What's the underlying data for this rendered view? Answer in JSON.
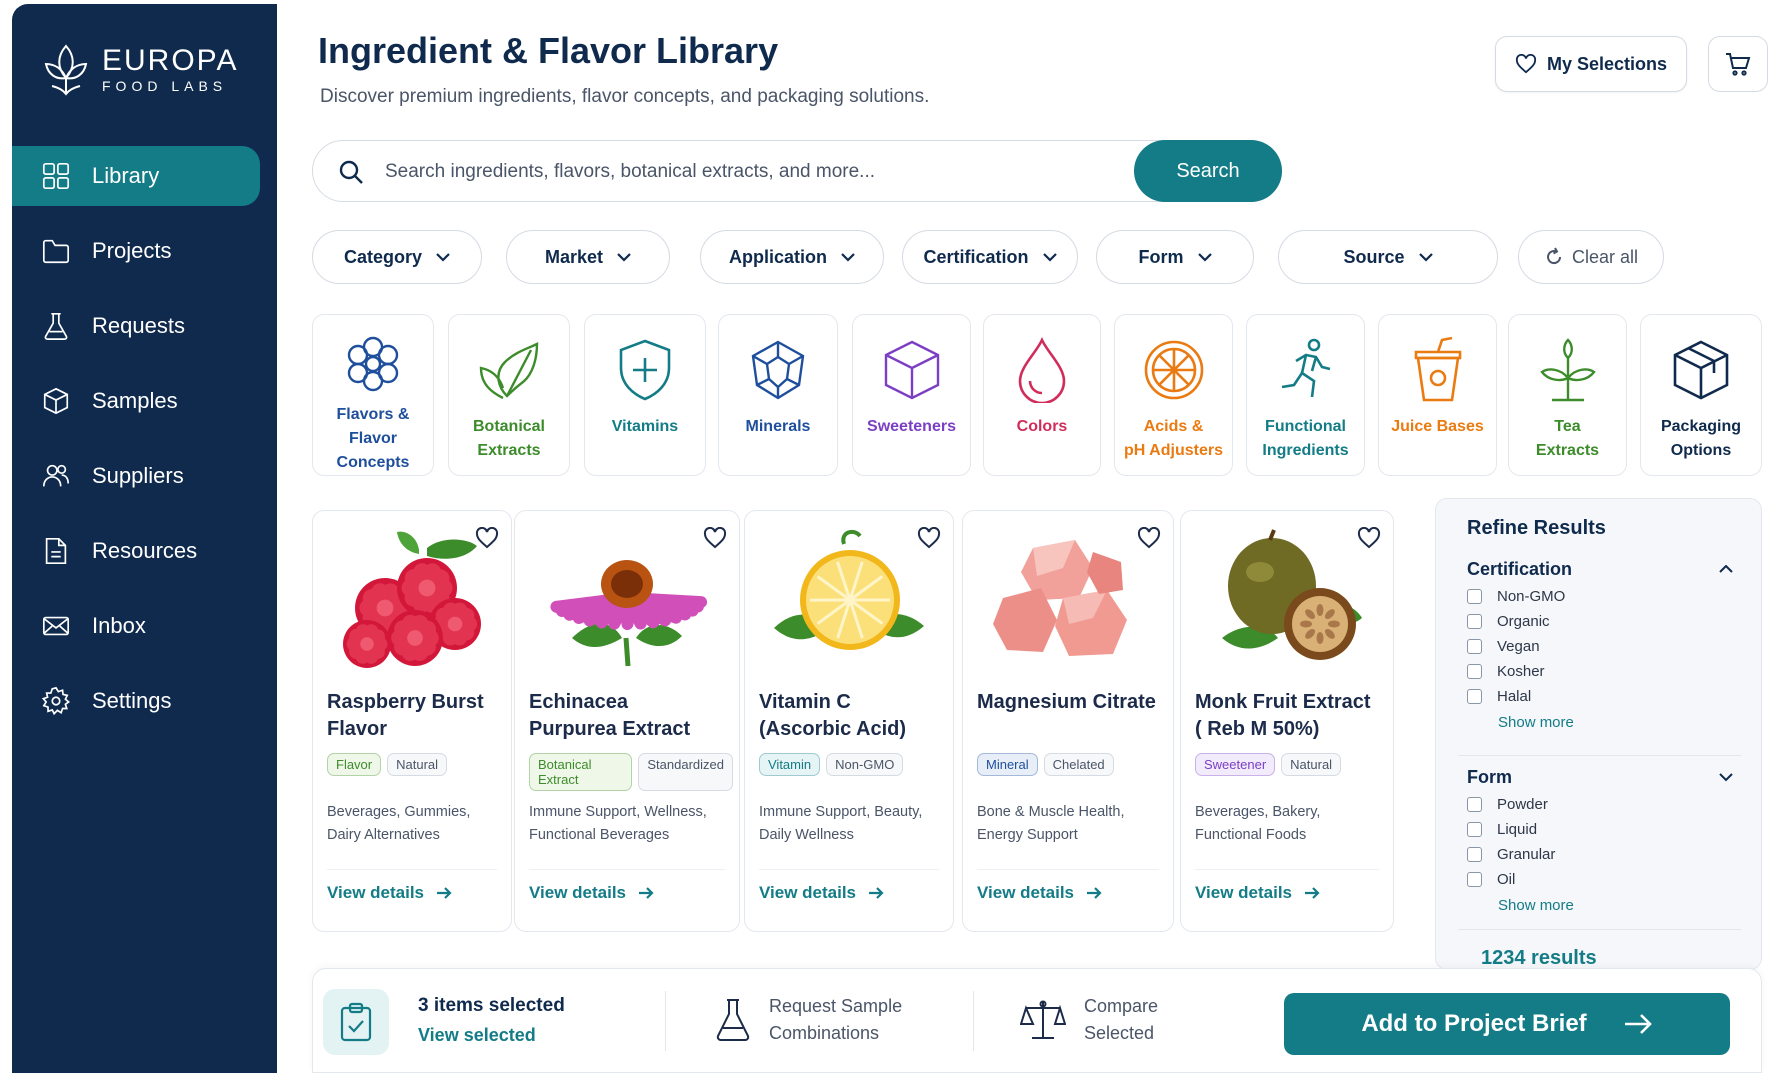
{
  "brand": {
    "name": "EUROPA",
    "sub": "FOOD LABS"
  },
  "sidebar": {
    "items": [
      {
        "label": "Library",
        "icon": "grid-icon",
        "active": true
      },
      {
        "label": "Projects",
        "icon": "folder-icon"
      },
      {
        "label": "Requests",
        "icon": "flask-icon"
      },
      {
        "label": "Samples",
        "icon": "box-icon"
      },
      {
        "label": "Suppliers",
        "icon": "users-icon"
      },
      {
        "label": "Resources",
        "icon": "document-icon"
      },
      {
        "label": "Inbox",
        "icon": "mail-icon"
      },
      {
        "label": "Settings",
        "icon": "gear-icon"
      }
    ]
  },
  "header": {
    "title": "Ingredient & Flavor Library",
    "subtitle": "Discover premium ingredients, flavor concepts, and packaging solutions.",
    "my_selections": "My Selections"
  },
  "search": {
    "placeholder": "Search ingredients, flavors, botanical extracts, and more...",
    "button": "Search"
  },
  "filters": [
    "Category",
    "Market",
    "Application",
    "Certification",
    "Form",
    "Source"
  ],
  "clear_all": "Clear all",
  "categories": [
    {
      "label": "Flavors &\nFlavor Concepts",
      "icon": "flower-icon",
      "color": "#1f4f9c"
    },
    {
      "label": "Botanical\nExtracts",
      "icon": "leaf-icon",
      "color": "#3d8c2b"
    },
    {
      "label": "Vitamins",
      "icon": "shield-plus-icon",
      "color": "#137c86"
    },
    {
      "label": "Minerals",
      "icon": "gem-icon",
      "color": "#1f4f9c"
    },
    {
      "label": "Sweeteners",
      "icon": "cube-icon",
      "color": "#7b3fc4"
    },
    {
      "label": "Colors",
      "icon": "drop-icon",
      "color": "#d12d5a"
    },
    {
      "label": "Acids &\npH Adjusters",
      "icon": "citrus-icon",
      "color": "#ea7b12"
    },
    {
      "label": "Functional\nIngredients",
      "icon": "runner-icon",
      "color": "#137c86"
    },
    {
      "label": "Juice Bases",
      "icon": "cup-icon",
      "color": "#ea7b12"
    },
    {
      "label": "Tea\nExtracts",
      "icon": "sprout-icon",
      "color": "#3d8c2b"
    },
    {
      "label": "Packaging\nOptions",
      "icon": "package-icon",
      "color": "#0f2a4d"
    }
  ],
  "products": [
    {
      "name": "Raspberry Burst Flavor",
      "tags": [
        {
          "t": "Flavor",
          "c": "#3d8c2b",
          "bg": "#eef7e8"
        },
        {
          "t": "Natural"
        }
      ],
      "uses": "Beverages, Gummies, Dairy Alternatives",
      "link": "View details",
      "image": "raspberry"
    },
    {
      "name": "Echinacea Purpurea Extract",
      "tags": [
        {
          "t": "Botanical Extract",
          "c": "#3d8c2b",
          "bg": "#eef7e8"
        },
        {
          "t": "Standardized"
        }
      ],
      "uses": "Immune Support, Wellness, Functional Beverages",
      "link": "View details",
      "image": "echinacea"
    },
    {
      "name": "Vitamin C (Ascorbic Acid)",
      "tags": [
        {
          "t": "Vitamin",
          "c": "#137c86",
          "bg": "#e6f4f5"
        },
        {
          "t": "Non-GMO"
        }
      ],
      "uses": "Immune Support, Beauty, Daily Wellness",
      "link": "View details",
      "image": "lemon"
    },
    {
      "name": "Magnesium Citrate",
      "tags": [
        {
          "t": "Mineral",
          "c": "#1f4f9c",
          "bg": "#e8eef8"
        },
        {
          "t": "Chelated"
        }
      ],
      "uses": "Bone & Muscle Health, Energy Support",
      "link": "View details",
      "image": "crystal"
    },
    {
      "name": "Monk Fruit Extract ( Reb M 50%)",
      "tags": [
        {
          "t": "Sweetener",
          "c": "#7b3fc4",
          "bg": "#f2ebfb"
        },
        {
          "t": "Natural"
        }
      ],
      "uses": "Beverages, Bakery, Functional Foods",
      "link": "View details",
      "image": "monkfruit"
    }
  ],
  "refine": {
    "title": "Refine Results",
    "sections": [
      {
        "title": "Certification",
        "options": [
          "Non-GMO",
          "Organic",
          "Vegan",
          "Kosher",
          "Halal"
        ],
        "more": "Show more",
        "expanded": true
      },
      {
        "title": "Form",
        "options": [
          "Powder",
          "Liquid",
          "Granular",
          "Oil"
        ],
        "more": "Show more",
        "expanded": false
      }
    ],
    "results": "1234 results"
  },
  "bottom": {
    "selected": "3 items selected",
    "view_selected": "View selected",
    "request": "Request Sample\nCombinations",
    "compare": "Compare\nSelected",
    "add": "Add to Project Brief"
  },
  "colors": {
    "navy": "#0f2a4d",
    "teal": "#137c86"
  }
}
